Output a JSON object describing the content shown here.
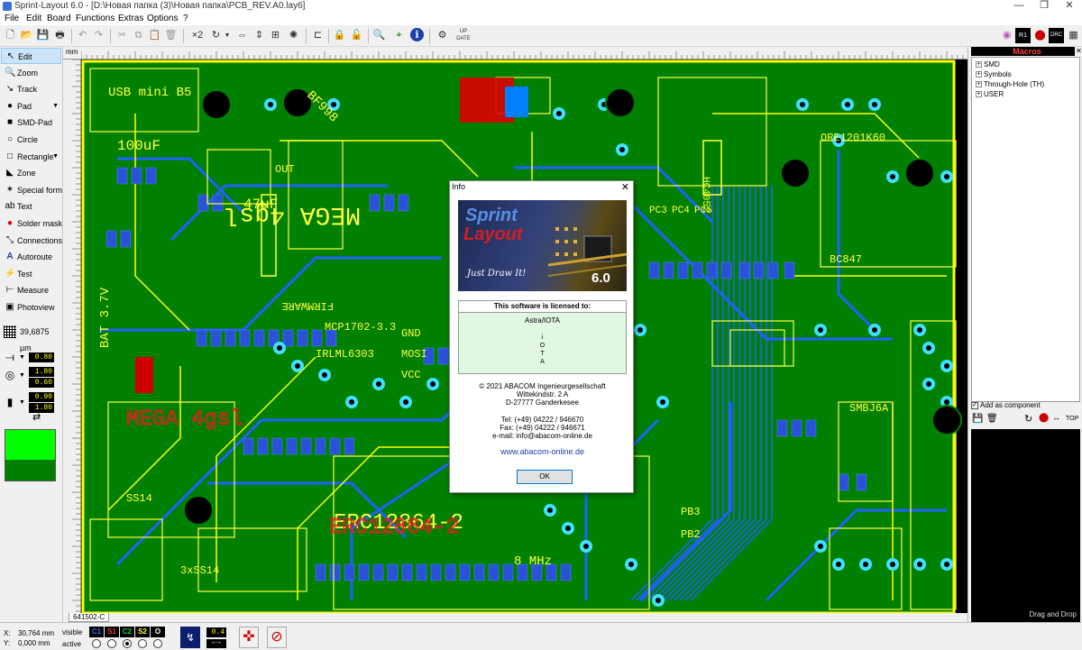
{
  "window": {
    "title": "Sprint-Layout 6.0 - [D:\\Новая папка (3)\\Новая папка\\PCB_REV.A0.lay6]",
    "min_glyph": "—",
    "max_glyph": "❐",
    "close_glyph": "✕"
  },
  "menu": [
    "File",
    "Edit",
    "Board",
    "Functions",
    "Extras",
    "Options",
    "?"
  ],
  "toolbar": {
    "x2_label": "×2",
    "update_label": "UP DATE"
  },
  "tools": [
    {
      "label": "Edit",
      "icon": "arrow-cursor-icon",
      "glyph": "↖",
      "active": true,
      "dropdown": false
    },
    {
      "label": "Zoom",
      "icon": "zoom-icon",
      "glyph": "🔍",
      "active": false,
      "dropdown": false
    },
    {
      "label": "Track",
      "icon": "track-icon",
      "glyph": "↘",
      "active": false,
      "dropdown": false
    },
    {
      "label": "Pad",
      "icon": "pad-icon",
      "glyph": "●",
      "active": false,
      "dropdown": true
    },
    {
      "label": "SMD-Pad",
      "icon": "smd-pad-icon",
      "glyph": "■",
      "active": false,
      "dropdown": false
    },
    {
      "label": "Circle",
      "icon": "circle-icon",
      "glyph": "○",
      "active": false,
      "dropdown": false
    },
    {
      "label": "Rectangle",
      "icon": "rectangle-icon",
      "glyph": "□",
      "active": false,
      "dropdown": true
    },
    {
      "label": "Zone",
      "icon": "zone-icon",
      "glyph": "◣",
      "active": false,
      "dropdown": false
    },
    {
      "label": "Special form",
      "icon": "special-form-icon",
      "glyph": "✶",
      "active": false,
      "dropdown": false
    },
    {
      "label": "Text",
      "icon": "text-icon",
      "glyph": "ab",
      "active": false,
      "dropdown": false
    },
    {
      "label": "Solder mask",
      "icon": "solder-mask-icon",
      "glyph": "●",
      "active": false,
      "dropdown": false
    },
    {
      "label": "Connections",
      "icon": "connections-icon",
      "glyph": "⤡",
      "active": false,
      "dropdown": false
    },
    {
      "label": "Autoroute",
      "icon": "autoroute-icon",
      "glyph": "A",
      "active": false,
      "dropdown": false
    },
    {
      "label": "Test",
      "icon": "test-icon",
      "glyph": "⚡",
      "active": false,
      "dropdown": false
    },
    {
      "label": "Measure",
      "icon": "measure-icon",
      "glyph": "⊢",
      "active": false,
      "dropdown": false
    },
    {
      "label": "Photoview",
      "icon": "photoview-icon",
      "glyph": "▣",
      "active": false,
      "dropdown": false
    }
  ],
  "grid": {
    "value": "39,6875 µm"
  },
  "track_params": {
    "track_width": "0.80",
    "pad_outer": "1.80",
    "pad_inner": "0.60",
    "smd_width": "0.90",
    "smd_height": "1.80"
  },
  "colors": {
    "current_layer": "#00ff00",
    "board": "#008000",
    "copper_top": "#ffff00",
    "copper_bottom": "#2060ff",
    "silk": "#ffff40",
    "pads": "#40e0ff"
  },
  "ruler": {
    "unit": "mm"
  },
  "board_tabs": [
    "641502-C"
  ],
  "macros": {
    "header": "Macros",
    "tree": [
      "SMD",
      "Symbols",
      "Through-Hole (TH)",
      "USER"
    ],
    "add_component": "Add as component",
    "top_label": "TOP",
    "drag_drop": "Drag and Drop"
  },
  "status": {
    "x_label": "X:",
    "x_value": "30,764 mm",
    "y_label": "Y:",
    "y_value": "0,000 mm",
    "visible_label": "visible",
    "active_label": "active",
    "layers": [
      {
        "name": "C1",
        "color": "#4060ff"
      },
      {
        "name": "S1",
        "color": "#ff3030"
      },
      {
        "name": "C2",
        "color": "#30c030"
      },
      {
        "name": "S2",
        "color": "#ffff30"
      },
      {
        "name": "O",
        "color": "#ffffff"
      }
    ],
    "snap_value": "0.4"
  },
  "dialog": {
    "title": "Info",
    "close": "✕",
    "logo_line1": "Sprint",
    "logo_line2": "Layout",
    "tagline": "Just Draw It!",
    "version": "6.0",
    "licensed_header": "This software is licensed to:",
    "licensee": "Astra/IOTA",
    "licensee_vertical": [
      "i",
      "O",
      "T",
      "A"
    ],
    "copyright": "© 2021 ABACOM Ingenieurgesellschaft",
    "street": "Wittekindstr. 2 A",
    "city": "D-27777 Ganderkesee",
    "tel": "Tel: (+49) 04222 / 946670",
    "fax": "Fax: (+49) 04222 / 946671",
    "email": "e-mail: info@abacom-online.de",
    "website": "www.abacom-online.de",
    "ok": "OK"
  },
  "pcb_labels": [
    "USB mini B5",
    "BF998",
    "MEGA 4gsl",
    "FIRMWARE",
    "MCP1702-3.3",
    "IRLML6303",
    "BAT 3.7V",
    "ERC12864-2",
    "8 MHz",
    "PB3",
    "PB2",
    "PC3",
    "PC4",
    "PC5",
    "47uF",
    "100uF",
    "SS14",
    "SMBJ6A",
    "ORE1201K60",
    "BC847",
    "HC4052",
    "OUT",
    "GND",
    "MOSI",
    "VCC",
    "3xSS14"
  ]
}
